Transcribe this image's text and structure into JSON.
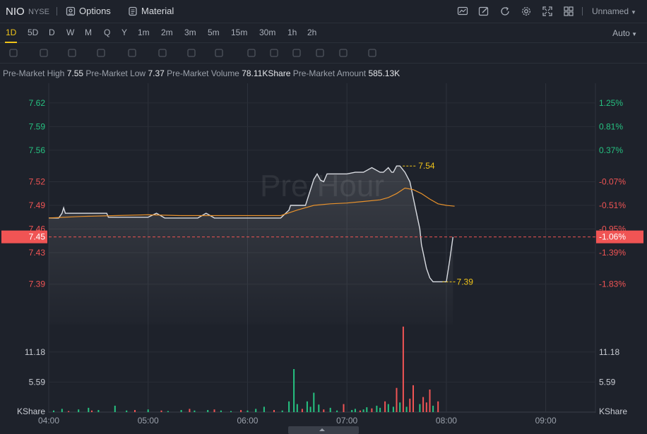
{
  "header": {
    "symbol": "NIO",
    "exchange": "NYSE",
    "options_label": "Options",
    "material_label": "Material",
    "layout_name": "Unnamed",
    "toolbar_icons": [
      "chart-type-icon",
      "draw-icon",
      "refresh-icon",
      "settings-icon",
      "fullscreen-icon",
      "layout-grid-icon"
    ]
  },
  "periods": [
    "1D",
    "5D",
    "D",
    "W",
    "M",
    "Q",
    "Y",
    "1m",
    "2m",
    "3m",
    "5m",
    "15m",
    "30m",
    "1h",
    "2h"
  ],
  "active_period": "1D",
  "scale_mode": "Auto",
  "drawing_tools": [
    "trendline-icon",
    "rectangle-icon",
    "pattern-icon",
    "fib-icon",
    "arrow-icon",
    "text-icon",
    "annotation-icon",
    "measure-icon",
    "pen-icon",
    "lock-icon",
    "eye-icon",
    "magnet-icon",
    "group-icon",
    "trash-icon"
  ],
  "premarket_stats": [
    {
      "label": "Pre-Market High",
      "value": "7.55"
    },
    {
      "label": "Pre-Market Low",
      "value": "7.37"
    },
    {
      "label": "Pre-Market Volume",
      "value": "78.11KShare"
    },
    {
      "label": "Pre-Market Amount",
      "value": "585.13K"
    }
  ],
  "colors": {
    "background": "#1e222b",
    "price_line": "#d9dce2",
    "avg_line": "#e8922c",
    "up": "#26c281",
    "down": "#f05454",
    "marker": "#f0c419"
  },
  "chart_data": {
    "type": "line",
    "watermark": "Pre Hour",
    "x_ticks": [
      "04:00",
      "05:00",
      "06:00",
      "07:00",
      "08:00",
      "09:00"
    ],
    "x_range_minutes": [
      0,
      330
    ],
    "price_axis": {
      "ylim": [
        7.37,
        7.645
      ],
      "left_ticks": [
        "7.62",
        "7.59",
        "7.56",
        "7.52",
        "7.49",
        "7.46",
        "7.43",
        "7.39"
      ],
      "right_ticks": [
        "1.25%",
        "0.81%",
        "0.37%",
        "-0.07%",
        "-0.51%",
        "-0.95%",
        "-1.39%",
        "-1.83%"
      ],
      "current_price": "7.45",
      "current_pct": "-1.06%",
      "high_label": "7.54",
      "low_label": "7.39"
    },
    "price_series": {
      "x": [
        0,
        6,
        8,
        9,
        10,
        12,
        14,
        35,
        36,
        40,
        45,
        60,
        65,
        70,
        73,
        80,
        90,
        95,
        100,
        120,
        140,
        145,
        146,
        150,
        155,
        160,
        162,
        164,
        166,
        168,
        170,
        175,
        180,
        185,
        190,
        195,
        200,
        202,
        205,
        207,
        208,
        210,
        212,
        215,
        218,
        220,
        222,
        224,
        225,
        226,
        228,
        230,
        232,
        234,
        236,
        238,
        240,
        242,
        244
      ],
      "y": [
        7.474,
        7.474,
        7.48,
        7.487,
        7.48,
        7.48,
        7.48,
        7.48,
        7.475,
        7.475,
        7.475,
        7.475,
        7.48,
        7.474,
        7.474,
        7.474,
        7.474,
        7.48,
        7.474,
        7.474,
        7.474,
        7.484,
        7.49,
        7.49,
        7.49,
        7.523,
        7.53,
        7.522,
        7.52,
        7.53,
        7.53,
        7.53,
        7.53,
        7.532,
        7.532,
        7.538,
        7.532,
        7.532,
        7.538,
        7.532,
        7.532,
        7.54,
        7.54,
        7.532,
        7.52,
        7.5,
        7.48,
        7.46,
        7.44,
        7.43,
        7.41,
        7.398,
        7.393,
        7.393,
        7.393,
        7.393,
        7.393,
        7.42,
        7.45
      ]
    },
    "avg_series": {
      "x": [
        0,
        20,
        40,
        60,
        80,
        100,
        120,
        140,
        150,
        160,
        170,
        180,
        190,
        200,
        205,
        210,
        215,
        220,
        225,
        230,
        235,
        240,
        245
      ],
      "y": [
        7.474,
        7.476,
        7.477,
        7.478,
        7.477,
        7.477,
        7.477,
        7.477,
        7.484,
        7.49,
        7.492,
        7.493,
        7.495,
        7.497,
        7.5,
        7.505,
        7.512,
        7.51,
        7.505,
        7.498,
        7.492,
        7.49,
        7.489
      ]
    },
    "volume_axis": {
      "ylim": [
        0,
        16
      ],
      "ticks": [
        "11.18",
        "5.59"
      ],
      "unit": "KShare"
    },
    "volume_bars": {
      "x": [
        3,
        8,
        12,
        18,
        24,
        26,
        30,
        40,
        47,
        52,
        60,
        68,
        72,
        80,
        85,
        88,
        96,
        100,
        104,
        110,
        116,
        120,
        125,
        130,
        136,
        141,
        145,
        148,
        150,
        153,
        156,
        158,
        160,
        163,
        166,
        170,
        174,
        178,
        183,
        185,
        188,
        190,
        192,
        195,
        198,
        200,
        203,
        205,
        208,
        210,
        212,
        214,
        216,
        218,
        220,
        224,
        226,
        228,
        230,
        232,
        235
      ],
      "v": [
        0.3,
        0.6,
        0.2,
        0.5,
        0.8,
        0.3,
        0.4,
        1.2,
        0.3,
        0.4,
        0.5,
        0.3,
        0.2,
        0.4,
        0.6,
        0.3,
        0.4,
        0.5,
        0.3,
        0.2,
        0.4,
        0.3,
        0.6,
        1.0,
        0.4,
        0.3,
        2.0,
        8.0,
        1.5,
        0.6,
        2.0,
        1.0,
        3.6,
        1.4,
        0.5,
        0.8,
        0.3,
        1.5,
        0.4,
        0.6,
        0.3,
        0.5,
        0.9,
        0.7,
        1.2,
        0.8,
        2.0,
        1.5,
        1.0,
        4.5,
        1.8,
        15.9,
        1.0,
        2.5,
        5.0,
        1.5,
        2.8,
        1.8,
        4.2,
        1.2,
        2.0
      ],
      "up": [
        true,
        true,
        false,
        true,
        true,
        false,
        true,
        true,
        true,
        false,
        true,
        false,
        true,
        true,
        false,
        true,
        true,
        false,
        true,
        true,
        false,
        true,
        true,
        true,
        false,
        true,
        true,
        true,
        true,
        false,
        true,
        true,
        true,
        true,
        false,
        true,
        true,
        false,
        true,
        true,
        false,
        true,
        true,
        false,
        true,
        true,
        false,
        true,
        true,
        false,
        true,
        false,
        true,
        false,
        false,
        true,
        false,
        false,
        false,
        true,
        false
      ]
    }
  }
}
